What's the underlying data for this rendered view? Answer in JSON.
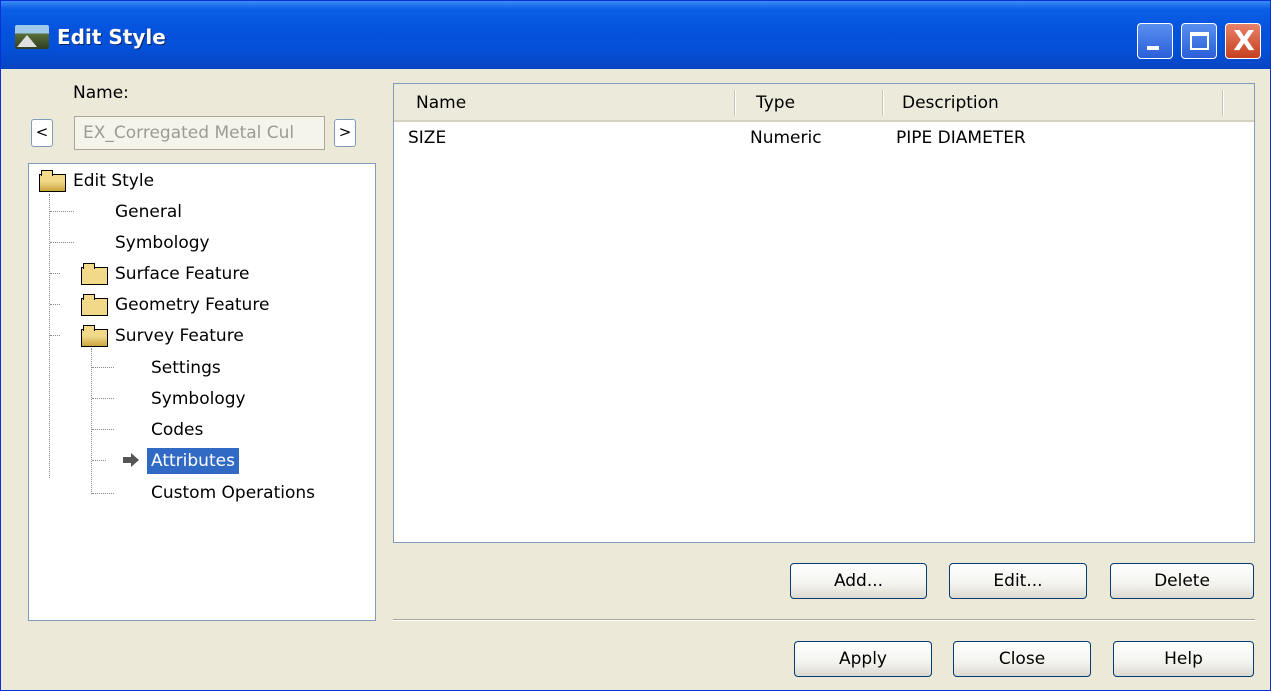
{
  "window": {
    "title": "Edit Style",
    "icon": "app-landscape-icon"
  },
  "name_section": {
    "label": "Name:",
    "value": "EX_Corregated Metal Cul",
    "prev_label": "<",
    "next_label": ">"
  },
  "tree": {
    "root": "Edit Style",
    "items": {
      "general": "General",
      "symbology": "Symbology",
      "surface_feature": "Surface Feature",
      "geometry_feature": "Geometry Feature",
      "survey_feature": "Survey Feature",
      "settings": "Settings",
      "survey_symbology": "Symbology",
      "codes": "Codes",
      "attributes": "Attributes",
      "custom_operations": "Custom Operations"
    },
    "selected": "Attributes"
  },
  "attribute_list": {
    "columns": [
      "Name",
      "Type",
      "Description"
    ],
    "rows": [
      {
        "name": "SIZE",
        "type": "Numeric",
        "description": "PIPE DIAMETER"
      }
    ]
  },
  "buttons": {
    "add": "Add...",
    "edit": "Edit...",
    "delete": "Delete",
    "apply": "Apply",
    "close": "Close",
    "help": "Help"
  },
  "titlebar_controls": {
    "close_glyph": "X"
  }
}
